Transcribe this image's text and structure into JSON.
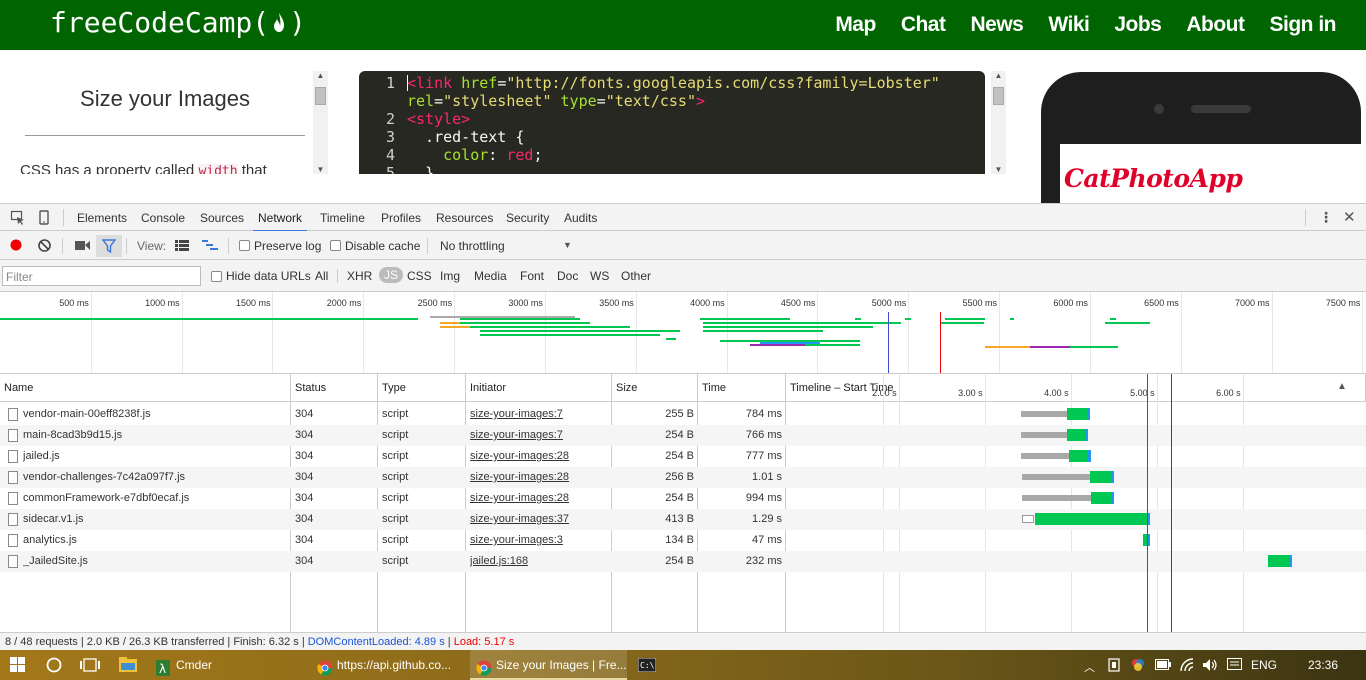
{
  "fcc": {
    "logo_left": "freeCodeCamp(",
    "logo_right": ")",
    "nav": [
      "Map",
      "Chat",
      "News",
      "Wiki",
      "Jobs",
      "About",
      "Sign in"
    ]
  },
  "challenge": {
    "title": "Size your Images",
    "desc_start": "CSS has a property called ",
    "desc_code": "width",
    "desc_end": " that"
  },
  "editor": {
    "lines": [
      {
        "n": "1",
        "parts": [
          [
            "tk-tag",
            "<link "
          ],
          [
            "tk-attr",
            "href"
          ],
          [
            "tk-white",
            "="
          ],
          [
            "tk-str",
            "\"http://fonts.googleapis.com/css?family=Lobster\""
          ]
        ]
      },
      {
        "n": "",
        "parts": [
          [
            "tk-attr",
            "rel"
          ],
          [
            "tk-white",
            "="
          ],
          [
            "tk-str",
            "\"stylesheet\""
          ],
          [
            "tk-white",
            " "
          ],
          [
            "tk-attr",
            "type"
          ],
          [
            "tk-white",
            "="
          ],
          [
            "tk-str",
            "\"text/css\""
          ],
          [
            "tk-tag",
            ">"
          ]
        ]
      },
      {
        "n": "2",
        "parts": [
          [
            "tk-tag",
            "<style>"
          ]
        ]
      },
      {
        "n": "3",
        "parts": [
          [
            "tk-white",
            "  .red-text {"
          ]
        ]
      },
      {
        "n": "4",
        "parts": [
          [
            "tk-attr",
            "    color"
          ],
          [
            "tk-white",
            ": "
          ],
          [
            "tk-red",
            "red"
          ],
          [
            "tk-white",
            ";"
          ]
        ]
      },
      {
        "n": "5",
        "parts": [
          [
            "tk-white",
            "  }"
          ]
        ]
      }
    ]
  },
  "preview": {
    "app_title": "CatPhotoApp"
  },
  "devtools": {
    "tabs": [
      "Elements",
      "Console",
      "Sources",
      "Network",
      "Timeline",
      "Profiles",
      "Resources",
      "Security",
      "Audits"
    ],
    "active_tab": "Network",
    "toolbar": {
      "view_label": "View:",
      "preserve_log": "Preserve log",
      "disable_cache": "Disable cache",
      "throttling": "No throttling"
    },
    "filter": {
      "placeholder": "Filter",
      "hide_data_urls": "Hide data URLs",
      "types": [
        "All",
        "XHR",
        "JS",
        "CSS",
        "Img",
        "Media",
        "Font",
        "Doc",
        "WS",
        "Other"
      ],
      "selected_type": "JS"
    },
    "overview_ticks": [
      "500 ms",
      "1000 ms",
      "1500 ms",
      "2000 ms",
      "2500 ms",
      "3000 ms",
      "3500 ms",
      "4000 ms",
      "4500 ms",
      "5000 ms",
      "5500 ms",
      "6000 ms",
      "6500 ms",
      "7000 ms",
      "7500 ms"
    ],
    "columns": [
      "Name",
      "Status",
      "Type",
      "Initiator",
      "Size",
      "Time",
      "Timeline – Start Time"
    ],
    "timeline_ticks": [
      "2.00 s",
      "3.00 s",
      "4.00 s",
      "5.00 s",
      "6.00 s"
    ],
    "rows": [
      {
        "name": "vendor-main-00eff8238f.js",
        "status": "304",
        "type": "script",
        "initiator": "size-your-images:7",
        "size": "255 B",
        "time": "784 ms",
        "wait_start_s": 3.42,
        "recv_start_s": 3.96,
        "end_s": 4.22
      },
      {
        "name": "main-8cad3b9d15.js",
        "status": "304",
        "type": "script",
        "initiator": "size-your-images:7",
        "size": "254 B",
        "time": "766 ms",
        "wait_start_s": 3.42,
        "recv_start_s": 3.96,
        "end_s": 4.2
      },
      {
        "name": "jailed.js",
        "status": "304",
        "type": "script",
        "initiator": "size-your-images:28",
        "size": "254 B",
        "time": "777 ms",
        "wait_start_s": 3.42,
        "recv_start_s": 3.98,
        "end_s": 4.24
      },
      {
        "name": "vendor-challenges-7c42a097f7.js",
        "status": "304",
        "type": "script",
        "initiator": "size-your-images:28",
        "size": "256 B",
        "time": "1.01 s",
        "wait_start_s": 3.44,
        "recv_start_s": 4.22,
        "end_s": 4.5
      },
      {
        "name": "commonFramework-e7dbf0ecaf.js",
        "status": "304",
        "type": "script",
        "initiator": "size-your-images:28",
        "size": "254 B",
        "time": "994 ms",
        "wait_start_s": 3.44,
        "recv_start_s": 4.24,
        "end_s": 4.5
      },
      {
        "name": "sidecar.v1.js",
        "status": "304",
        "type": "script",
        "initiator": "size-your-images:37",
        "size": "413 B",
        "time": "1.29 s",
        "wait_start_s": 3.44,
        "recv_start_s": 3.58,
        "end_s": 4.92
      },
      {
        "name": "analytics.js",
        "status": "304",
        "type": "script",
        "initiator": "size-your-images:3",
        "size": "134 B",
        "time": "47 ms",
        "wait_start_s": 4.84,
        "recv_start_s": 4.84,
        "end_s": 4.92
      },
      {
        "name": "_JailedSite.js",
        "status": "304",
        "type": "script",
        "initiator": "jailed.js:168",
        "size": "254 B",
        "time": "232 ms",
        "wait_start_s": 6.3,
        "recv_start_s": 6.3,
        "end_s": 6.57
      }
    ],
    "dom_content_loaded_s": 4.89,
    "load_s": 5.17,
    "status": {
      "requests": "8 / 48 requests",
      "transferred": "2.0 KB / 26.3 KB transferred",
      "finish": "Finish: 6.32 s",
      "dcl": "DOMContentLoaded: 4.89 s",
      "load": "Load: 5.17 s"
    }
  },
  "taskbar": {
    "items": [
      "Cmder",
      "https://api.github.co...",
      "Size your Images | Fre..."
    ],
    "lang": "ENG",
    "clock": "23:36"
  },
  "colors": {
    "fcc_green": "#006400",
    "waterfall_green": "#00c853",
    "waterfall_blue": "#2196f3",
    "waiting_gray": "#a8a8a8"
  }
}
